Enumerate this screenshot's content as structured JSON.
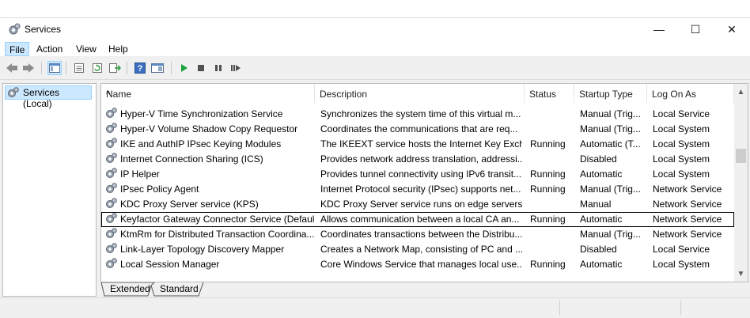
{
  "window": {
    "title": "Services",
    "minimize": "—",
    "maximize": "☐",
    "close": "✕"
  },
  "menu": [
    {
      "label": "File"
    },
    {
      "label": "Action"
    },
    {
      "label": "View"
    },
    {
      "label": "Help"
    }
  ],
  "toolbar": {
    "icons": [
      "back-arrow-icon",
      "forward-arrow-icon",
      "console-tree-icon",
      "properties-icon",
      "refresh-icon",
      "export-list-icon",
      "help-icon",
      "show-hide-action-pane-icon",
      "start-service-icon",
      "stop-service-icon",
      "pause-service-icon",
      "resume-service-icon"
    ]
  },
  "tree": {
    "item": "Services (Local)"
  },
  "columns": [
    {
      "label": "Name"
    },
    {
      "label": "Description"
    },
    {
      "label": "Status"
    },
    {
      "label": "Startup Type"
    },
    {
      "label": "Log On As"
    }
  ],
  "rows": [
    {
      "name": "Hyper-V Time Synchronization Service",
      "description": "Synchronizes the system time of this virtual m...",
      "status": "",
      "startup": "Manual (Trig...",
      "logon": "Local Service"
    },
    {
      "name": "Hyper-V Volume Shadow Copy Requestor",
      "description": "Coordinates the communications that are req...",
      "status": "",
      "startup": "Manual (Trig...",
      "logon": "Local System"
    },
    {
      "name": "IKE and AuthIP IPsec Keying Modules",
      "description": "The IKEEXT service hosts the Internet Key Exch...",
      "status": "Running",
      "startup": "Automatic (T...",
      "logon": "Local System"
    },
    {
      "name": "Internet Connection Sharing (ICS)",
      "description": "Provides network address translation, addressi...",
      "status": "",
      "startup": "Disabled",
      "logon": "Local System"
    },
    {
      "name": "IP Helper",
      "description": "Provides tunnel connectivity using IPv6 transit...",
      "status": "Running",
      "startup": "Automatic",
      "logon": "Local System"
    },
    {
      "name": "IPsec Policy Agent",
      "description": "Internet Protocol security (IPsec) supports net...",
      "status": "Running",
      "startup": "Manual (Trig...",
      "logon": "Network Service"
    },
    {
      "name": "KDC Proxy Server service (KPS)",
      "description": "KDC Proxy Server service runs on edge servers ...",
      "status": "",
      "startup": "Manual",
      "logon": "Network Service"
    },
    {
      "name": "Keyfactor Gateway Connector Service (Default)",
      "description": "Allows communication between a local CA an...",
      "status": "Running",
      "startup": "Automatic",
      "logon": "Network Service",
      "selected": true
    },
    {
      "name": "KtmRm for Distributed Transaction Coordina...",
      "description": "Coordinates transactions between the Distribu...",
      "status": "",
      "startup": "Manual (Trig...",
      "logon": "Network Service"
    },
    {
      "name": "Link-Layer Topology Discovery Mapper",
      "description": "Creates a Network Map, consisting of PC and ...",
      "status": "",
      "startup": "Disabled",
      "logon": "Local Service"
    },
    {
      "name": "Local Session Manager",
      "description": "Core Windows Service that manages local use...",
      "status": "Running",
      "startup": "Automatic",
      "logon": "Local System"
    }
  ],
  "tabs": [
    {
      "label": "Extended"
    },
    {
      "label": "Standard"
    }
  ],
  "colors": {
    "selection_bg": "#cce8ff",
    "selection_border": "#99d1ff",
    "play_green": "#1aa33a"
  }
}
